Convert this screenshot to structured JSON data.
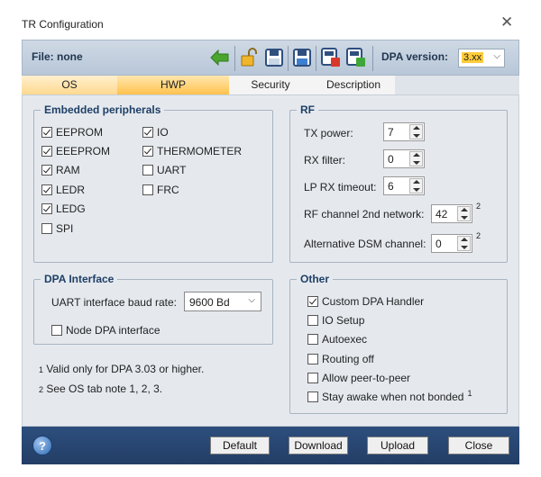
{
  "window": {
    "title": "TR Configuration",
    "close_glyph": "✕"
  },
  "toolbar": {
    "file_label": "File: none",
    "icons": [
      "back-arrow-icon",
      "unlock-icon",
      "save-icon",
      "save-as-icon",
      "upload-red-icon",
      "upload-green-icon"
    ],
    "dpa_version_label": "DPA version:",
    "dpa_version_value": "3.xx"
  },
  "tabs": [
    {
      "label": "OS",
      "active": false
    },
    {
      "label": "HWP",
      "active": true
    },
    {
      "label": "Security",
      "active": false
    },
    {
      "label": "Description",
      "active": false
    }
  ],
  "embedded": {
    "title": "Embedded peripherals",
    "left": [
      {
        "label": "EEPROM",
        "checked": true
      },
      {
        "label": "EEEPROM",
        "checked": true
      },
      {
        "label": "RAM",
        "checked": true
      },
      {
        "label": "LEDR",
        "checked": true
      },
      {
        "label": "LEDG",
        "checked": true
      },
      {
        "label": "SPI",
        "checked": false
      }
    ],
    "right": [
      {
        "label": "IO",
        "checked": true
      },
      {
        "label": "THERMOMETER",
        "checked": true
      },
      {
        "label": "UART",
        "checked": false
      },
      {
        "label": "FRC",
        "checked": false
      }
    ]
  },
  "rf": {
    "title": "RF",
    "tx_power": {
      "label": "TX power:",
      "value": "7"
    },
    "rx_filter": {
      "label": "RX filter:",
      "value": "0"
    },
    "lp_rx_timeout": {
      "label": "LP RX timeout:",
      "value": "6"
    },
    "rf_channel_2nd": {
      "label": "RF channel 2nd network:",
      "value": "42",
      "sup": "2"
    },
    "alt_dsm": {
      "label": "Alternative DSM channel:",
      "value": "0",
      "sup": "2"
    }
  },
  "dpa_interface": {
    "title": "DPA Interface",
    "baud_label": "UART interface baud rate:",
    "baud_value": "9600 Bd",
    "node_dpa": {
      "label": "Node DPA interface",
      "checked": false
    }
  },
  "notes": {
    "n1_sup": "1",
    "n1": "Valid only for DPA 3.03 or higher.",
    "n2_sup": "2",
    "n2": "See OS tab note 1, 2, 3."
  },
  "other": {
    "title": "Other",
    "items": [
      {
        "label": "Custom DPA Handler",
        "checked": true
      },
      {
        "label": "IO Setup",
        "checked": false
      },
      {
        "label": "Autoexec",
        "checked": false
      },
      {
        "label": "Routing off",
        "checked": false
      },
      {
        "label": "Allow peer-to-peer",
        "checked": false
      },
      {
        "label": "Stay awake when not bonded",
        "checked": false,
        "sup": "1"
      }
    ]
  },
  "bottom": {
    "help_glyph": "?",
    "default_label": "Default",
    "download_label": "Download",
    "upload_label": "Upload",
    "close_label": "Close"
  }
}
